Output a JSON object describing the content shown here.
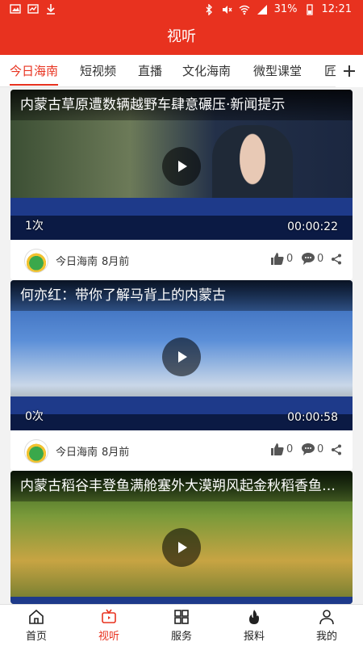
{
  "status_bar": {
    "battery": "31%",
    "time": "12:21"
  },
  "app_bar": {
    "title": "视听"
  },
  "tabs": [
    "今日海南",
    "短视频",
    "直播",
    "文化海南",
    "微型课堂",
    "匠"
  ],
  "cards": [
    {
      "title": "内蒙古草原遭数辆越野车肆意碾压·新闻提示",
      "left_meta": "1次",
      "duration": "00:00:22",
      "source": "今日海南",
      "time": "8月前",
      "likes": "0",
      "comments": "0"
    },
    {
      "title": "何亦红：带你了解马背上的内蒙古",
      "left_meta": "0次",
      "duration": "00:00:58",
      "source": "今日海南",
      "time": "8月前",
      "likes": "0",
      "comments": "0"
    },
    {
      "title": "内蒙古稻谷丰登鱼满舱塞外大漠朔风起金秋稻香鱼儿肥",
      "left_meta": "",
      "duration": "",
      "source": "",
      "time": "",
      "likes": "",
      "comments": ""
    }
  ],
  "bottom_nav": [
    {
      "label": "首页",
      "icon": "home-icon"
    },
    {
      "label": "视听",
      "icon": "tv-icon"
    },
    {
      "label": "服务",
      "icon": "grid-icon"
    },
    {
      "label": "报料",
      "icon": "fire-icon"
    },
    {
      "label": "我的",
      "icon": "user-icon"
    }
  ],
  "colors": {
    "brand": "#e8321f"
  }
}
